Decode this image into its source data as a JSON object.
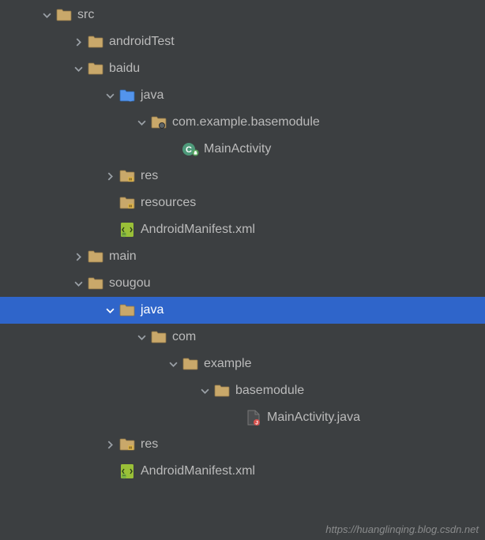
{
  "watermark": "https://huanglinqing.blog.csdn.net",
  "colors": {
    "bg": "#3c3f41",
    "text": "#bbbbbb",
    "selectedBg": "#2f65ca",
    "folderFill": "#c9a86a",
    "folderStroke": "#8e7547",
    "srcBlue": "#5394ec",
    "xmlGreen": "#9ac038",
    "classCircle": "#4e9a7a",
    "fileFill": "#4b4d4f",
    "errorBadge": "#d9534f"
  },
  "tree": [
    {
      "id": "src",
      "indent": 0,
      "expand": "open",
      "icon": "folder",
      "label": "src"
    },
    {
      "id": "androidTest",
      "indent": 1,
      "expand": "closed",
      "icon": "folder",
      "label": "androidTest"
    },
    {
      "id": "baidu",
      "indent": 1,
      "expand": "open",
      "icon": "folder",
      "label": "baidu"
    },
    {
      "id": "baidu-java",
      "indent": 2,
      "expand": "open",
      "icon": "folder-src",
      "label": "java"
    },
    {
      "id": "baidu-pkg",
      "indent": 3,
      "expand": "open",
      "icon": "package",
      "label": "com.example.basemodule"
    },
    {
      "id": "baidu-main",
      "indent": 4,
      "expand": "none",
      "icon": "class",
      "label": "MainActivity"
    },
    {
      "id": "baidu-res",
      "indent": 2,
      "expand": "closed",
      "icon": "folder-res",
      "label": "res"
    },
    {
      "id": "baidu-resources",
      "indent": 2,
      "expand": "none",
      "icon": "folder-res",
      "label": "resources"
    },
    {
      "id": "baidu-manifest",
      "indent": 2,
      "expand": "none",
      "icon": "xml-manifest",
      "label": "AndroidManifest.xml"
    },
    {
      "id": "main",
      "indent": 1,
      "expand": "closed",
      "icon": "folder",
      "label": "main"
    },
    {
      "id": "sougou",
      "indent": 1,
      "expand": "open",
      "icon": "folder",
      "label": "sougou"
    },
    {
      "id": "sougou-java",
      "indent": 2,
      "expand": "open",
      "icon": "folder",
      "label": "java",
      "selected": true
    },
    {
      "id": "sougou-com",
      "indent": 3,
      "expand": "open",
      "icon": "folder",
      "label": "com"
    },
    {
      "id": "sougou-example",
      "indent": 4,
      "expand": "open",
      "icon": "folder",
      "label": "example"
    },
    {
      "id": "sougou-basemod",
      "indent": 5,
      "expand": "open",
      "icon": "folder",
      "label": "basemodule"
    },
    {
      "id": "sougou-main",
      "indent": 6,
      "expand": "none",
      "icon": "file-error",
      "label": "MainActivity.java"
    },
    {
      "id": "sougou-res",
      "indent": 2,
      "expand": "closed",
      "icon": "folder-res",
      "label": "res"
    },
    {
      "id": "sougou-manifest",
      "indent": 2,
      "expand": "none",
      "icon": "xml-manifest",
      "label": "AndroidManifest.xml"
    }
  ]
}
